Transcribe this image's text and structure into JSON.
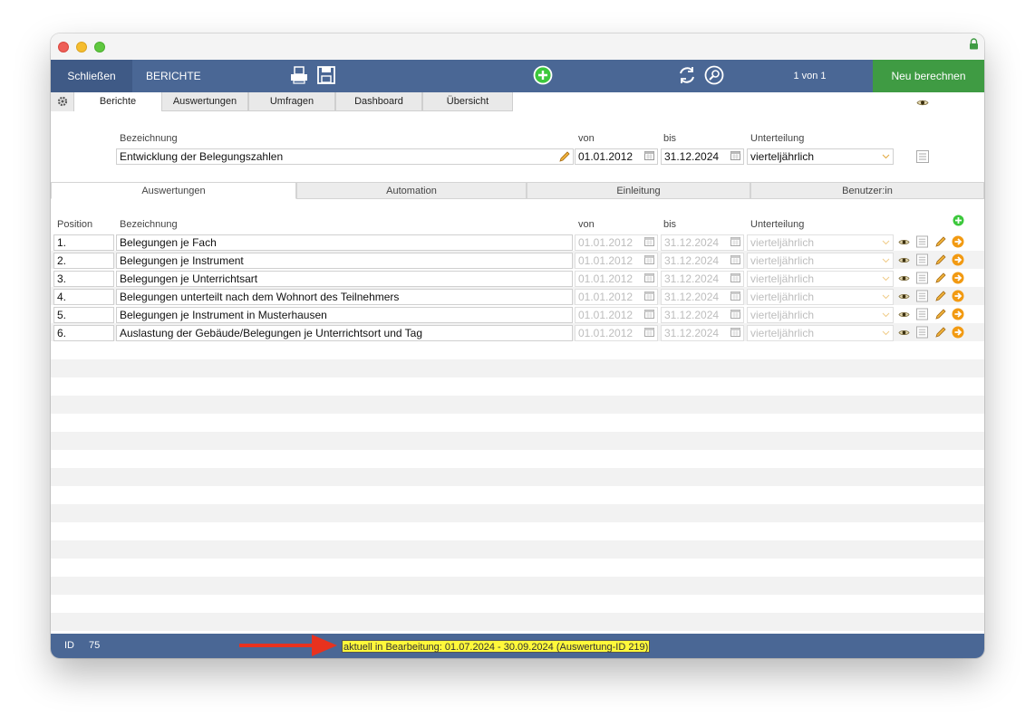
{
  "toolbar": {
    "close_label": "Schließen",
    "title": "BERICHTE",
    "record_count": "1 von 1",
    "recalc_label": "Neu berechnen",
    "icons": [
      "print-icon",
      "save-icon",
      "add-icon",
      "refresh-icon",
      "search-icon"
    ]
  },
  "top_tabs": [
    "Berichte",
    "Auswertungen",
    "Umfragen",
    "Dashboard",
    "Übersicht"
  ],
  "report": {
    "name_label": "Bezeichnung",
    "name_value": "Entwicklung der Belegungszahlen",
    "from_label": "von",
    "from_value": "01.01.2012",
    "to_label": "bis",
    "to_value": "31.12.2024",
    "division_label": "Unterteilung",
    "division_value": "vierteljährlich"
  },
  "sub_tabs": [
    "Auswertungen",
    "Automation",
    "Einleitung",
    "Benutzer:in"
  ],
  "list_headers": {
    "position": "Position",
    "name": "Bezeichnung",
    "from": "von",
    "to": "bis",
    "division": "Unterteilung"
  },
  "rows": [
    {
      "position": "1.",
      "name": "Belegungen je Fach",
      "from": "01.01.2012",
      "to": "31.12.2024",
      "division": "vierteljährlich"
    },
    {
      "position": "2.",
      "name": "Belegungen je Instrument",
      "from": "01.01.2012",
      "to": "31.12.2024",
      "division": "vierteljährlich"
    },
    {
      "position": "3.",
      "name": "Belegungen je Unterrichtsart",
      "from": "01.01.2012",
      "to": "31.12.2024",
      "division": "vierteljährlich"
    },
    {
      "position": "4.",
      "name": "Belegungen unterteilt nach dem Wohnort des Teilnehmers",
      "from": "01.01.2012",
      "to": "31.12.2024",
      "division": "vierteljährlich"
    },
    {
      "position": "5.",
      "name": "Belegungen je Instrument in Musterhausen",
      "from": "01.01.2012",
      "to": "31.12.2024",
      "division": "vierteljährlich"
    },
    {
      "position": "6.",
      "name": "Auslastung der Gebäude/Belegungen je Unterrichtsort und Tag",
      "from": "01.01.2012",
      "to": "31.12.2024",
      "division": "vierteljährlich"
    }
  ],
  "status": {
    "id_label": "ID",
    "id_value": "75",
    "message": "aktuell in Bearbeitung: 01.07.2024 - 30.09.2024 (Auswertung-ID 219)"
  },
  "colors": {
    "toolbar": "#4a6795",
    "recalc": "#3f9b43",
    "highlight": "#fff83a",
    "annotation_arrow": "#e8321e",
    "action_orange": "#f29a12"
  }
}
